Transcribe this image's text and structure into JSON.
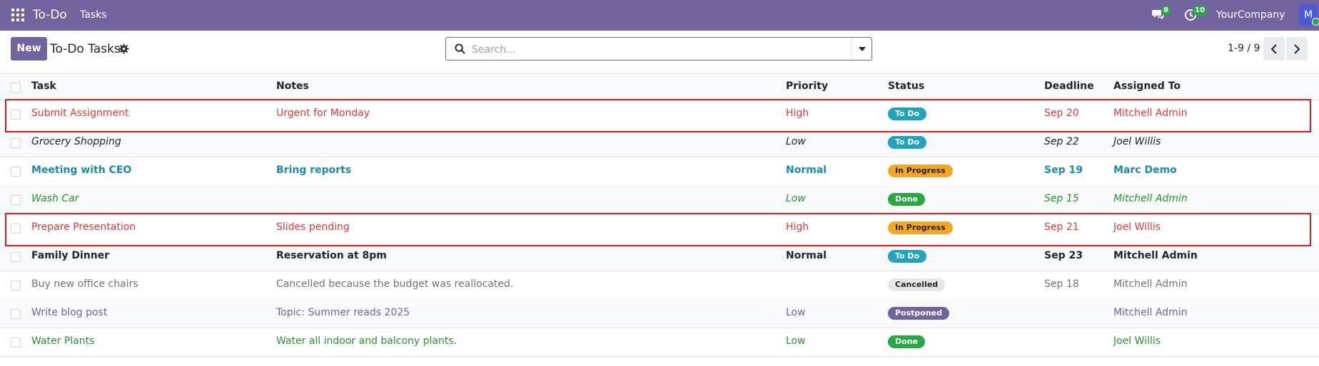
{
  "navbar": {
    "brand": "To-Do",
    "menu_tasks": "Tasks",
    "messages_count": "8",
    "activities_count": "10",
    "company": "YourCompany",
    "avatar_initial": "M"
  },
  "control": {
    "new_label": "New",
    "title": "To-Do Tasks",
    "search_placeholder": "Search...",
    "pager_value": "1-9 / 9"
  },
  "table": {
    "headers": {
      "task": "Task",
      "notes": "Notes",
      "priority": "Priority",
      "status": "Status",
      "deadline": "Deadline",
      "assigned": "Assigned To"
    },
    "rows": [
      {
        "task": "Submit Assignment",
        "notes": "Urgent for Monday",
        "priority": "High",
        "status": "To Do",
        "deadline": "Sep 20",
        "assigned": "Mitchell Admin"
      },
      {
        "task": "Grocery Shopping",
        "notes": "",
        "priority": "Low",
        "status": "To Do",
        "deadline": "Sep 22",
        "assigned": "Joel Willis"
      },
      {
        "task": "Meeting with CEO",
        "notes": "Bring reports",
        "priority": "Normal",
        "status": "In Progress",
        "deadline": "Sep 19",
        "assigned": "Marc Demo"
      },
      {
        "task": "Wash Car",
        "notes": "",
        "priority": "Low",
        "status": "Done",
        "deadline": "Sep 15",
        "assigned": "Mitchell Admin"
      },
      {
        "task": "Prepare Presentation",
        "notes": "Slides pending",
        "priority": "High",
        "status": "In Progress",
        "deadline": "Sep 21",
        "assigned": "Joel Willis"
      },
      {
        "task": "Family Dinner",
        "notes": "Reservation at 8pm",
        "priority": "Normal",
        "status": "To Do",
        "deadline": "Sep 23",
        "assigned": "Mitchell Admin"
      },
      {
        "task": "Buy new office chairs",
        "notes": "Cancelled because the budget was reallocated.",
        "priority": "",
        "status": "Cancelled",
        "deadline": "Sep 18",
        "assigned": "Mitchell Admin"
      },
      {
        "task": "Write blog post",
        "notes": "Topic: Summer reads 2025",
        "priority": "Low",
        "status": "Postponed",
        "deadline": "",
        "assigned": "Mitchell Admin"
      },
      {
        "task": "Water Plants",
        "notes": "Water all indoor and balcony plants.",
        "priority": "Low",
        "status": "Done",
        "deadline": "",
        "assigned": "Joel Willis"
      }
    ]
  },
  "colors": {
    "brand": "#71639e",
    "danger": "#d9383d",
    "info": "#1a8aa8",
    "success": "#28922f",
    "muted": "#6c757d",
    "todo": "#20a3bc",
    "in_progress": "#f5a623",
    "done": "#28a745",
    "cancelled": "#e4e6e8",
    "postponed": "#71639e",
    "highlight": "#e01b24"
  }
}
